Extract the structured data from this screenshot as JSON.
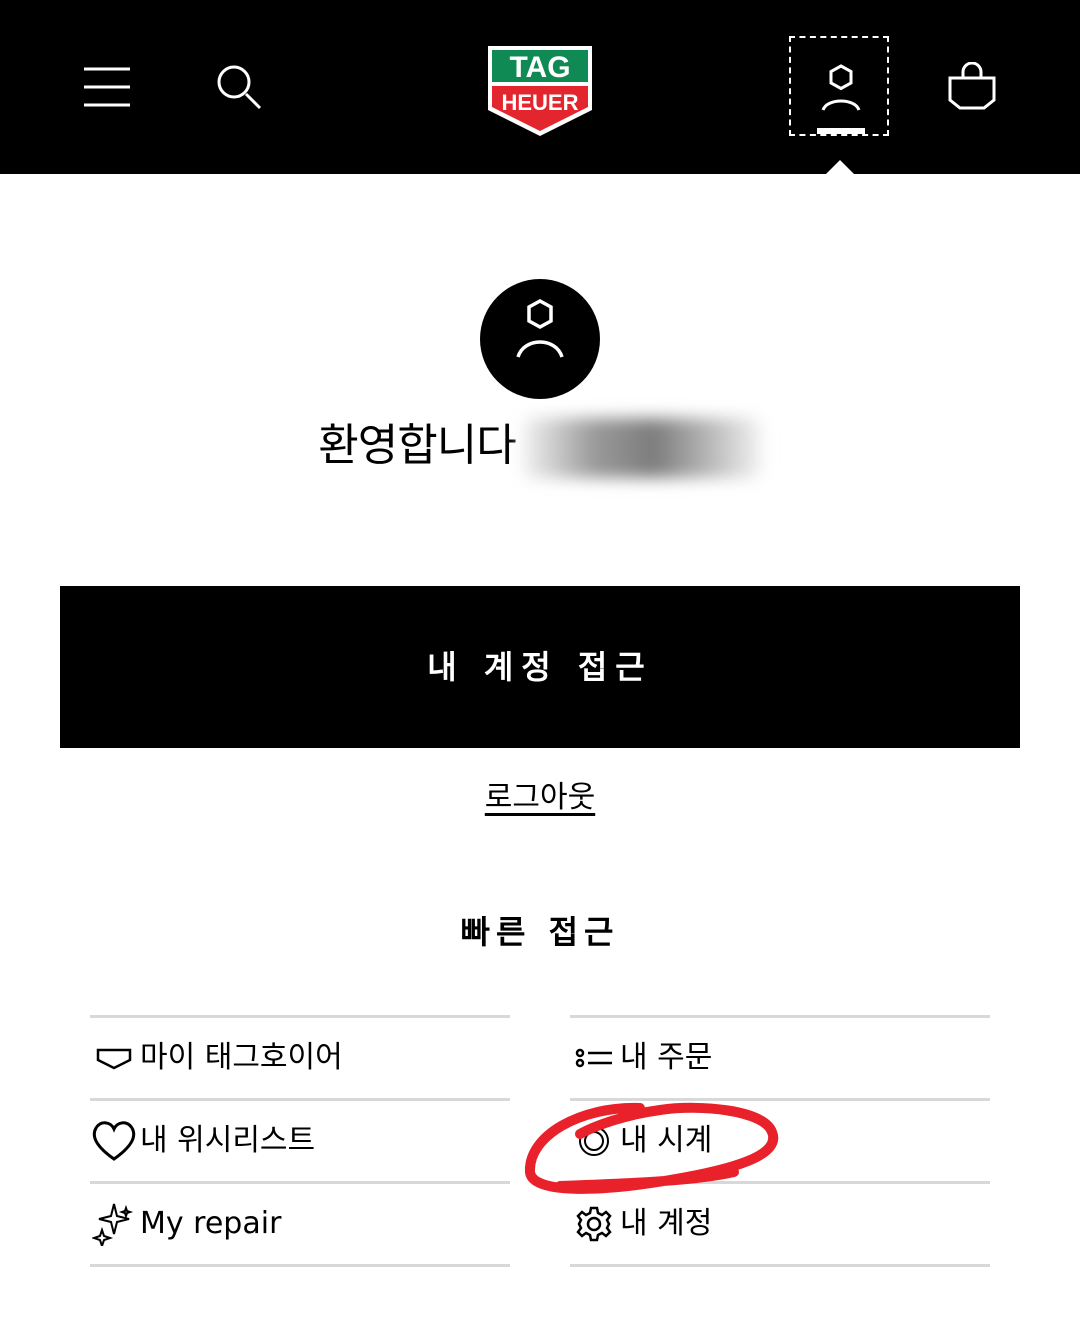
{
  "header": {
    "menu_icon": "hamburger-menu-icon",
    "search_icon": "search-icon",
    "logo": {
      "top": "TAG",
      "bottom": "HEUER",
      "colors": {
        "green": "#0f8a55",
        "red": "#e3262d"
      }
    },
    "account_icon": "user-hexagon-icon",
    "bag_icon": "shopping-bag-icon"
  },
  "profile": {
    "welcome": "환영합니다",
    "name_redacted": true
  },
  "cta": {
    "label": "내 계정 접근"
  },
  "logout": {
    "label": "로그아웃"
  },
  "quick_access": {
    "title": "빠른 접근",
    "left": [
      {
        "icon": "watch-case-icon",
        "label": "마이 태그호이어"
      },
      {
        "icon": "heart-icon",
        "label": "내 위시리스트"
      },
      {
        "icon": "sparkles-icon",
        "label": "My repair"
      }
    ],
    "right": [
      {
        "icon": "orders-list-icon",
        "label": "내 주문"
      },
      {
        "icon": "watch-icon",
        "label": "내 시계"
      },
      {
        "icon": "gear-icon",
        "label": "내 계정"
      }
    ]
  },
  "annotation": {
    "color": "#e8212b",
    "target": "내 시계"
  },
  "colors": {
    "header_bg": "#000000",
    "divider": "#d8d8d8"
  }
}
